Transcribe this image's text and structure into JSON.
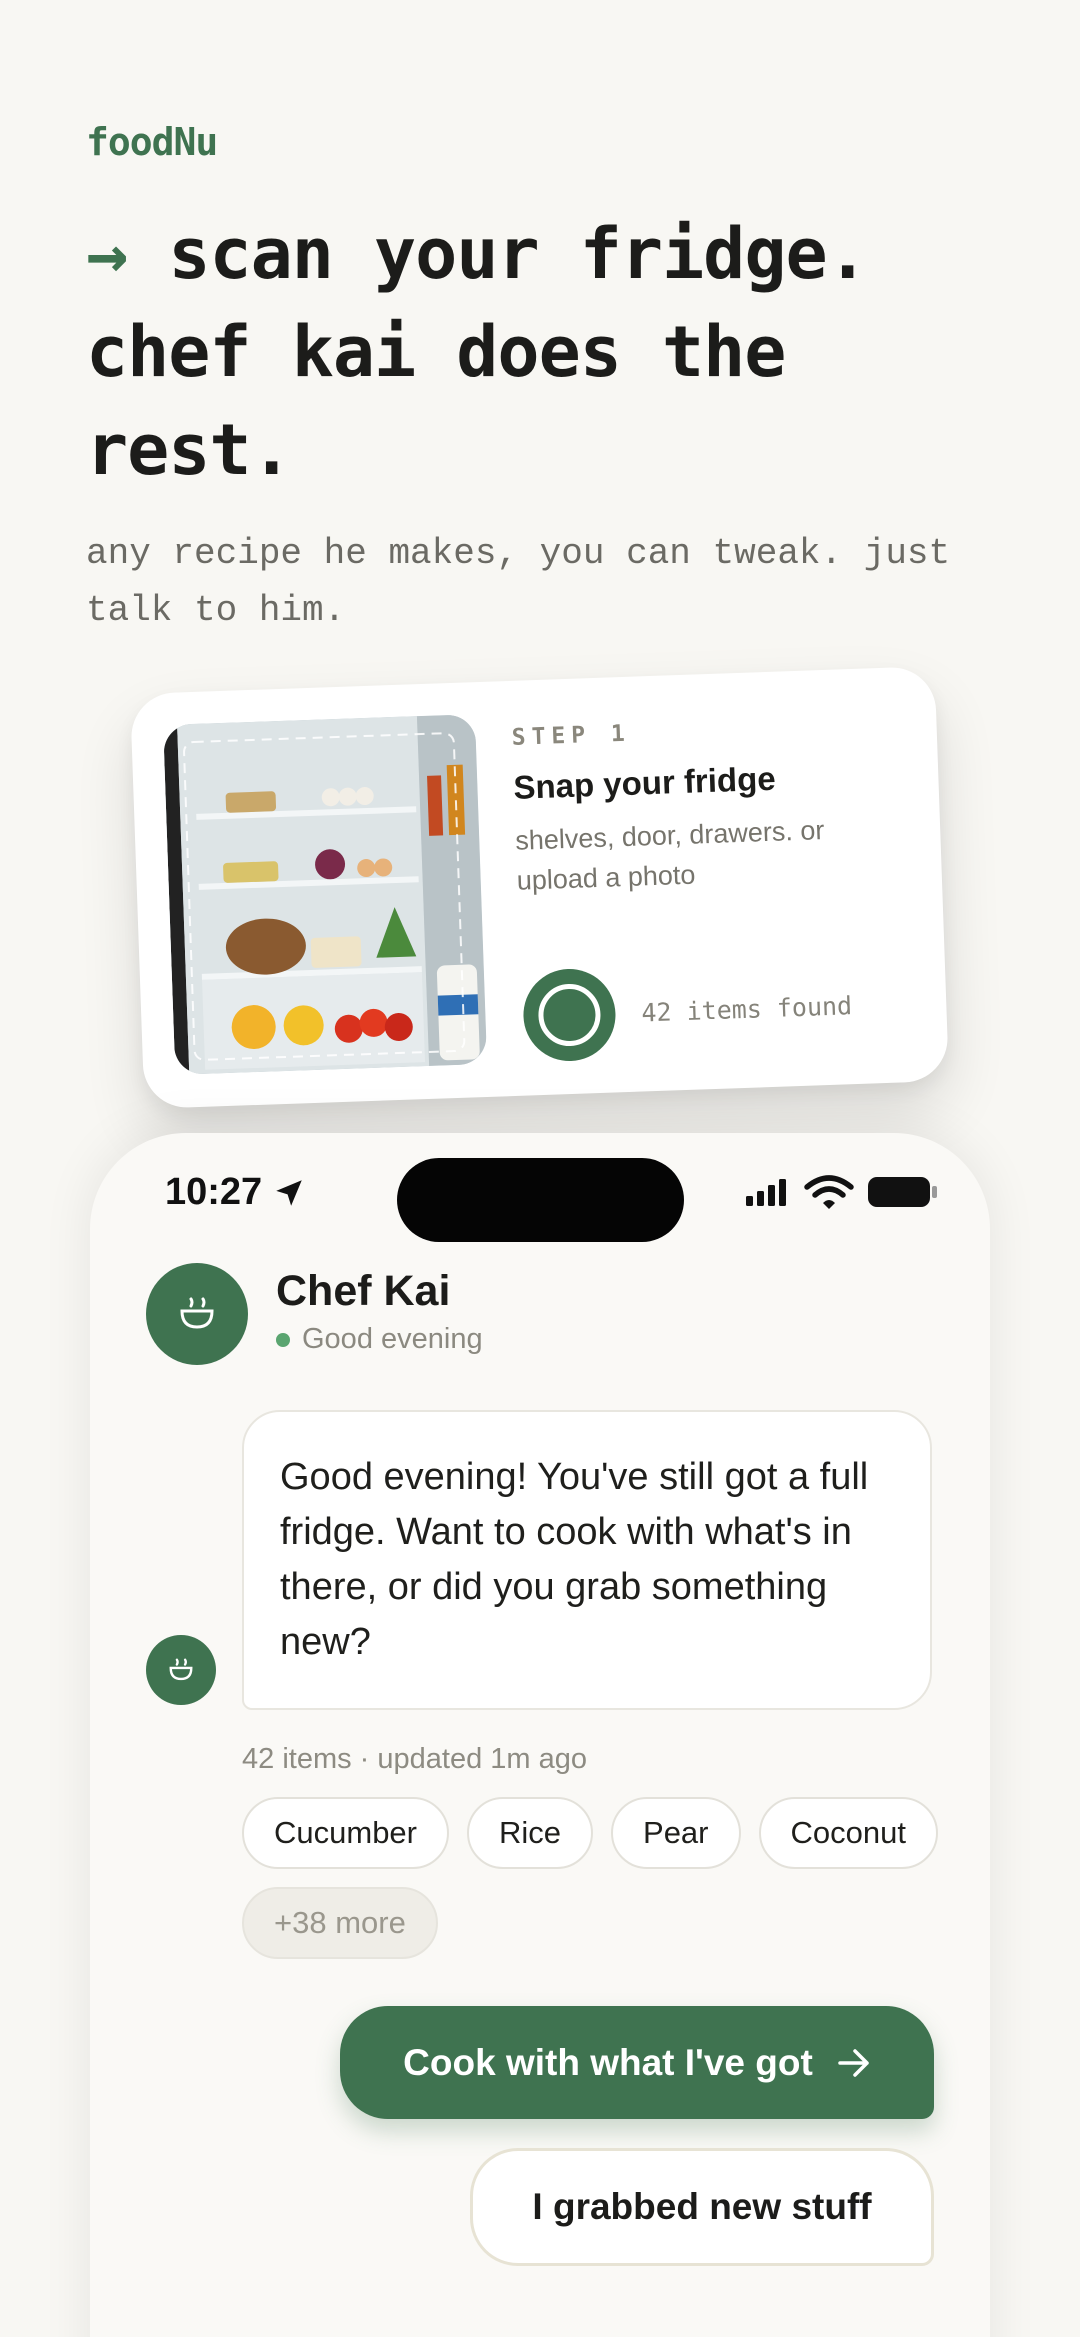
{
  "brand": "foodNu",
  "hero": {
    "arrow": "→",
    "headline": "scan your fridge. chef kai does the rest.",
    "subhead": "any recipe he makes, you can tweak. just talk to him."
  },
  "step_card": {
    "label": "STEP 1",
    "title": "Snap your fridge",
    "description": "shelves, door, drawers. or upload a photo",
    "items_found": "42 items found"
  },
  "phone": {
    "status_time": "10:27",
    "chef": {
      "name": "Chef Kai",
      "status": "Good evening"
    },
    "message": "Good evening! You've still got a full fridge. Want to cook with what's in there, or did you grab something new?",
    "inventory_meta": "42 items · updated 1m ago",
    "chips": [
      "Cucumber",
      "Rice",
      "Pear",
      "Coconut"
    ],
    "more_chip": "+38 more",
    "primary_action": "Cook with what I've got",
    "secondary_action": "I grabbed new stuff"
  },
  "colors": {
    "accent": "#3f7350",
    "background": "#f8f7f3",
    "online": "#5aa570"
  },
  "icons": [
    "location-arrow-icon",
    "signal-icon",
    "wifi-icon",
    "battery-icon",
    "cooking-pot-icon",
    "arrow-right-icon"
  ]
}
